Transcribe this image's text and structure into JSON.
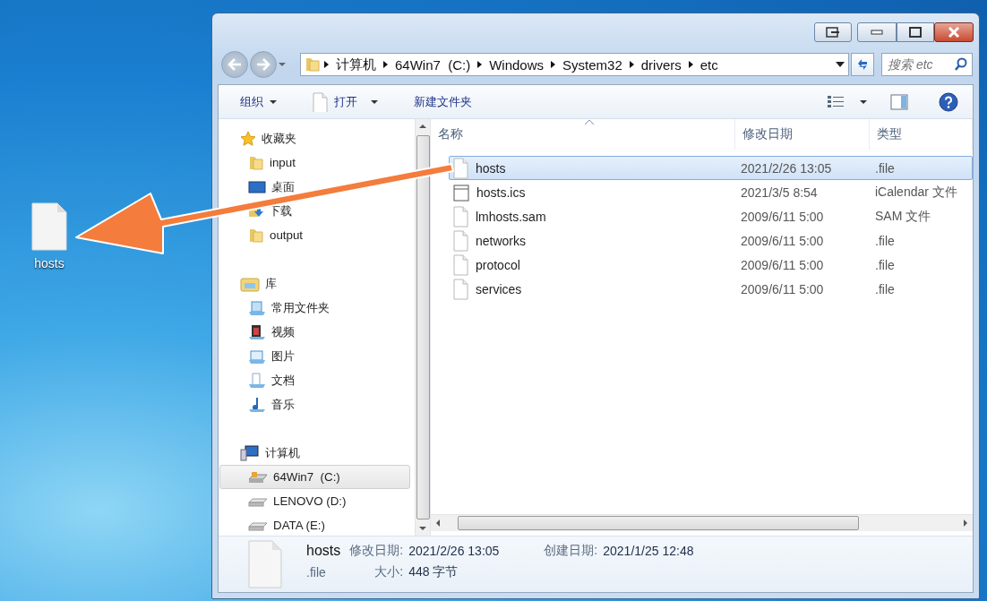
{
  "desktop_icon": {
    "label": "hosts"
  },
  "window": {
    "address": {
      "crumbs": [
        "计算机",
        "64Win7  (C:)",
        "Windows",
        "System32",
        "drivers",
        "etc"
      ]
    },
    "search": {
      "placeholder": "搜索 etc"
    },
    "toolbar": [
      {
        "label": "组织",
        "kind": "menu"
      },
      {
        "label": "打开",
        "kind": "open"
      },
      {
        "label": "新建文件夹",
        "kind": "button"
      }
    ],
    "navigation": [
      {
        "label": "收藏夹",
        "kind": "favorites",
        "selected": false,
        "children": [
          {
            "label": "input",
            "kind": "folder",
            "selected": false
          },
          {
            "label": "桌面",
            "kind": "desktop",
            "selected": false
          },
          {
            "label": "下载",
            "kind": "download",
            "selected": false
          },
          {
            "label": "output",
            "kind": "folder",
            "selected": false
          }
        ]
      },
      {
        "label": "库",
        "kind": "library",
        "selected": false,
        "children": [
          {
            "label": "常用文件夹",
            "kind": "library-item",
            "selected": false
          },
          {
            "label": "视频",
            "kind": "video",
            "selected": false
          },
          {
            "label": "图片",
            "kind": "picture",
            "selected": false
          },
          {
            "label": "文档",
            "kind": "document",
            "selected": false
          },
          {
            "label": "音乐",
            "kind": "music",
            "selected": false
          }
        ]
      },
      {
        "label": "计算机",
        "kind": "computer",
        "selected": false,
        "children": [
          {
            "label": "64Win7  (C:)",
            "kind": "system-drive",
            "selected": true
          },
          {
            "label": "LENOVO (D:)",
            "kind": "drive",
            "selected": false
          },
          {
            "label": "DATA (E:)",
            "kind": "drive",
            "selected": false
          }
        ]
      }
    ],
    "columns": [
      {
        "label": "名称",
        "sorted": true
      },
      {
        "label": "修改日期",
        "sorted": false
      },
      {
        "label": "类型",
        "sorted": false
      }
    ],
    "files": [
      {
        "name": "hosts",
        "modified": "2021/2/26 13:05",
        "type": ".file",
        "kind": "file",
        "selected": true
      },
      {
        "name": "hosts.ics",
        "modified": "2021/3/5 8:54",
        "type": "iCalendar 文件",
        "kind": "calendar",
        "selected": false
      },
      {
        "name": "lmhosts.sam",
        "modified": "2009/6/11 5:00",
        "type": "SAM 文件",
        "kind": "file",
        "selected": false
      },
      {
        "name": "networks",
        "modified": "2009/6/11 5:00",
        "type": ".file",
        "kind": "file",
        "selected": false
      },
      {
        "name": "protocol",
        "modified": "2009/6/11 5:00",
        "type": ".file",
        "kind": "file",
        "selected": false
      },
      {
        "name": "services",
        "modified": "2009/6/11 5:00",
        "type": ".file",
        "kind": "file",
        "selected": false
      }
    ],
    "details": {
      "name": "hosts",
      "type": ".file",
      "fields": [
        {
          "label": "修改日期:",
          "value": "2021/2/26 13:05"
        },
        {
          "label": "创建日期:",
          "value": "2021/1/25 12:48"
        },
        {
          "label": "大小:",
          "value": "448 字节"
        }
      ]
    }
  }
}
